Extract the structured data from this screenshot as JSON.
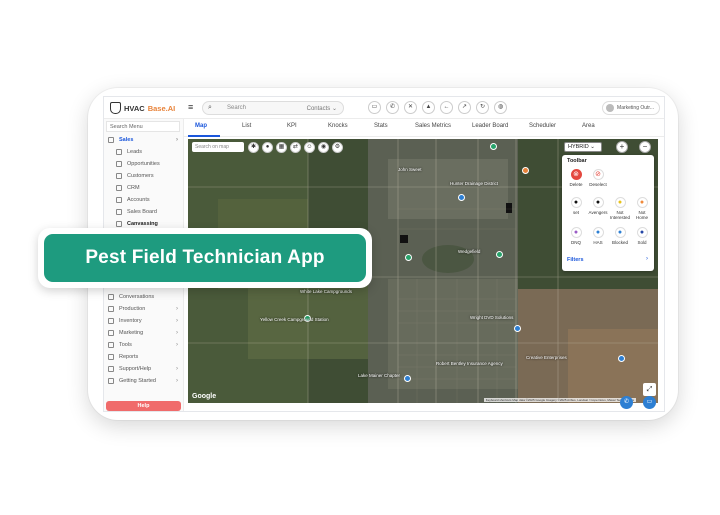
{
  "app": {
    "logo_prefix": "HVAC",
    "logo_suffix": "Base.AI"
  },
  "header": {
    "search_placeholder": "Search",
    "search_scope": "Contacts ⌄",
    "user_label": "Marketing Outr...",
    "icons": [
      "chat-icon",
      "phone-icon",
      "x-icon",
      "bell-icon",
      "back-icon",
      "forward-icon",
      "refresh-icon",
      "headset-icon"
    ]
  },
  "sidebar": {
    "search_label": "Search Menu",
    "sales": "Sales",
    "items": [
      "Leads",
      "Opportunities",
      "Customers",
      "CRM",
      "Accounts",
      "Sales Board",
      "Canvassing"
    ],
    "lower": [
      "Conversations",
      "Production",
      "Inventory",
      "Marketing",
      "Tools",
      "Reports",
      "Support/Help",
      "Getting Started"
    ],
    "help": "Help"
  },
  "tabs": [
    "Map",
    "List",
    "KPI",
    "Knocks",
    "Stats",
    "Sales Metrics",
    "Leader Board",
    "Scheduler",
    "Area"
  ],
  "map": {
    "search_placeholder": "Search on map",
    "map_type": "HYBRID ⌄",
    "google": "Google",
    "attribution": "Keyboard shortcuts   Map data ©2025 Google Imagery ©2025 Airbus, Landsat / Copernicus, Maxar Technologies",
    "places": [
      "John Sweet",
      "Hunter Drainage District",
      "Wedgefield",
      "White Lake Campgrounds",
      "Yellow Creek Campground Station",
      "Wright DVD Solutions",
      "Creative Enterprises",
      "Robert Bentley Insurance Agency",
      "Lake Mainer Chapter"
    ]
  },
  "toolbar": {
    "title": "Toolbar",
    "items": [
      {
        "label": "Delete",
        "color": "#e4483f"
      },
      {
        "label": "Deselect",
        "color": "#e4483f"
      },
      {
        "label": "set",
        "color": "#111111"
      },
      {
        "label": "Avengers",
        "color": "#111111"
      },
      {
        "label": "Not Interested",
        "color": "#e8c21a"
      },
      {
        "label": "Not Home",
        "color": "#f08a3b"
      },
      {
        "label": "DNQ",
        "color": "#9a5cc6"
      },
      {
        "label": "HAS",
        "color": "#2d7fd3"
      },
      {
        "label": "Blocked",
        "color": "#2d7fd3"
      },
      {
        "label": "Sold",
        "color": "#2446a6"
      }
    ],
    "filters": "Filters"
  },
  "overlay": {
    "text": "Pest Field Technician App"
  }
}
